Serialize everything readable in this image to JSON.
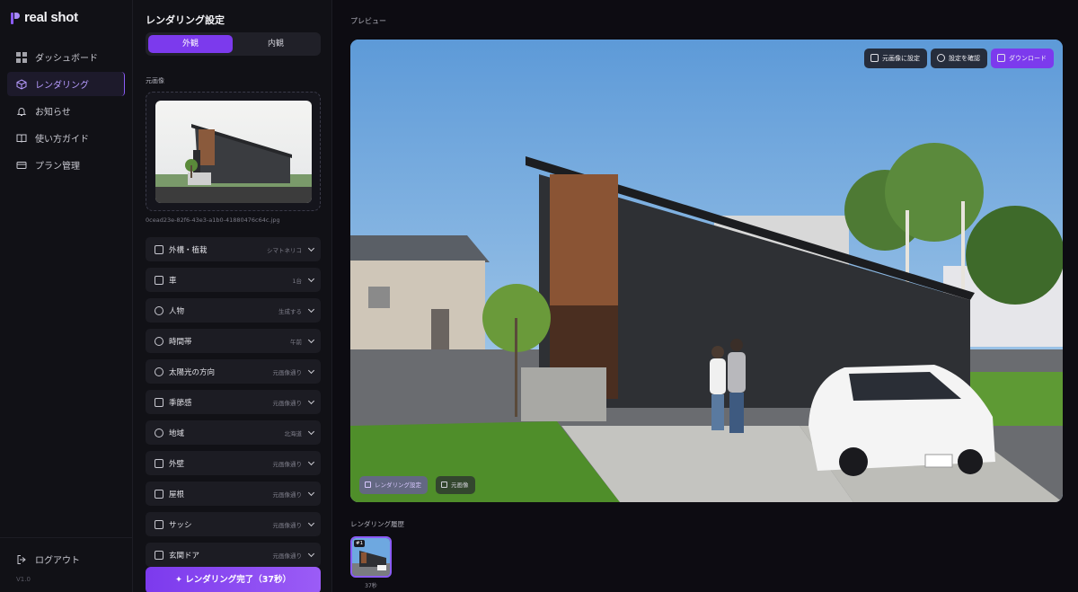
{
  "app": {
    "logo_text": "real shot",
    "version": "V1.0"
  },
  "sidebar": {
    "items": [
      {
        "label": "ダッシュボード",
        "icon": "grid-icon",
        "active": false
      },
      {
        "label": "レンダリング",
        "icon": "cube-icon",
        "active": true
      },
      {
        "label": "お知らせ",
        "icon": "bell-icon",
        "active": false
      },
      {
        "label": "使い方ガイド",
        "icon": "book-icon",
        "active": false
      },
      {
        "label": "プラン管理",
        "icon": "card-icon",
        "active": false
      }
    ],
    "logout_label": "ログアウト"
  },
  "panel": {
    "title": "レンダリング設定",
    "tabs": [
      {
        "label": "外観",
        "selected": true
      },
      {
        "label": "内観",
        "selected": false
      }
    ],
    "original_label": "元画像",
    "filename": "0cead23e-82f6-43e3-a1b0-41880476c64c.jpg",
    "options": [
      {
        "label": "外構・植栽",
        "value": "シマトネリコ",
        "icon": "plant-icon"
      },
      {
        "label": "車",
        "value": "1台",
        "icon": "car-icon"
      },
      {
        "label": "人物",
        "value": "生成する",
        "icon": "people-icon"
      },
      {
        "label": "時間帯",
        "value": "午前",
        "icon": "clock-icon"
      },
      {
        "label": "太陽光の方向",
        "value": "元画像通り",
        "icon": "sun-icon"
      },
      {
        "label": "季節感",
        "value": "元画像通り",
        "icon": "leaf-icon"
      },
      {
        "label": "地域",
        "value": "北海道",
        "icon": "pin-icon"
      },
      {
        "label": "外壁",
        "value": "元画像通り",
        "icon": "brush-icon"
      },
      {
        "label": "屋根",
        "value": "元画像通り",
        "icon": "house-icon"
      },
      {
        "label": "サッシ",
        "value": "元画像通り",
        "icon": "window-icon"
      },
      {
        "label": "玄関ドア",
        "value": "元画像通り",
        "icon": "door-icon"
      }
    ],
    "render_button": "レンダリング完了（37秒）"
  },
  "main": {
    "preview_label": "プレビュー",
    "toolbar": {
      "set_original": "元画像に設定",
      "view_settings": "設定を確認",
      "download": "ダウンロード"
    },
    "pills": {
      "render_setting": "レンダリング設定",
      "original": "元画像"
    },
    "history_label": "レンダリング履歴",
    "history": [
      {
        "badge": "#1",
        "caption": "37秒"
      }
    ]
  },
  "colors": {
    "accent": "#7c3aed",
    "background": "#0b0b10",
    "panel": "#111116"
  }
}
